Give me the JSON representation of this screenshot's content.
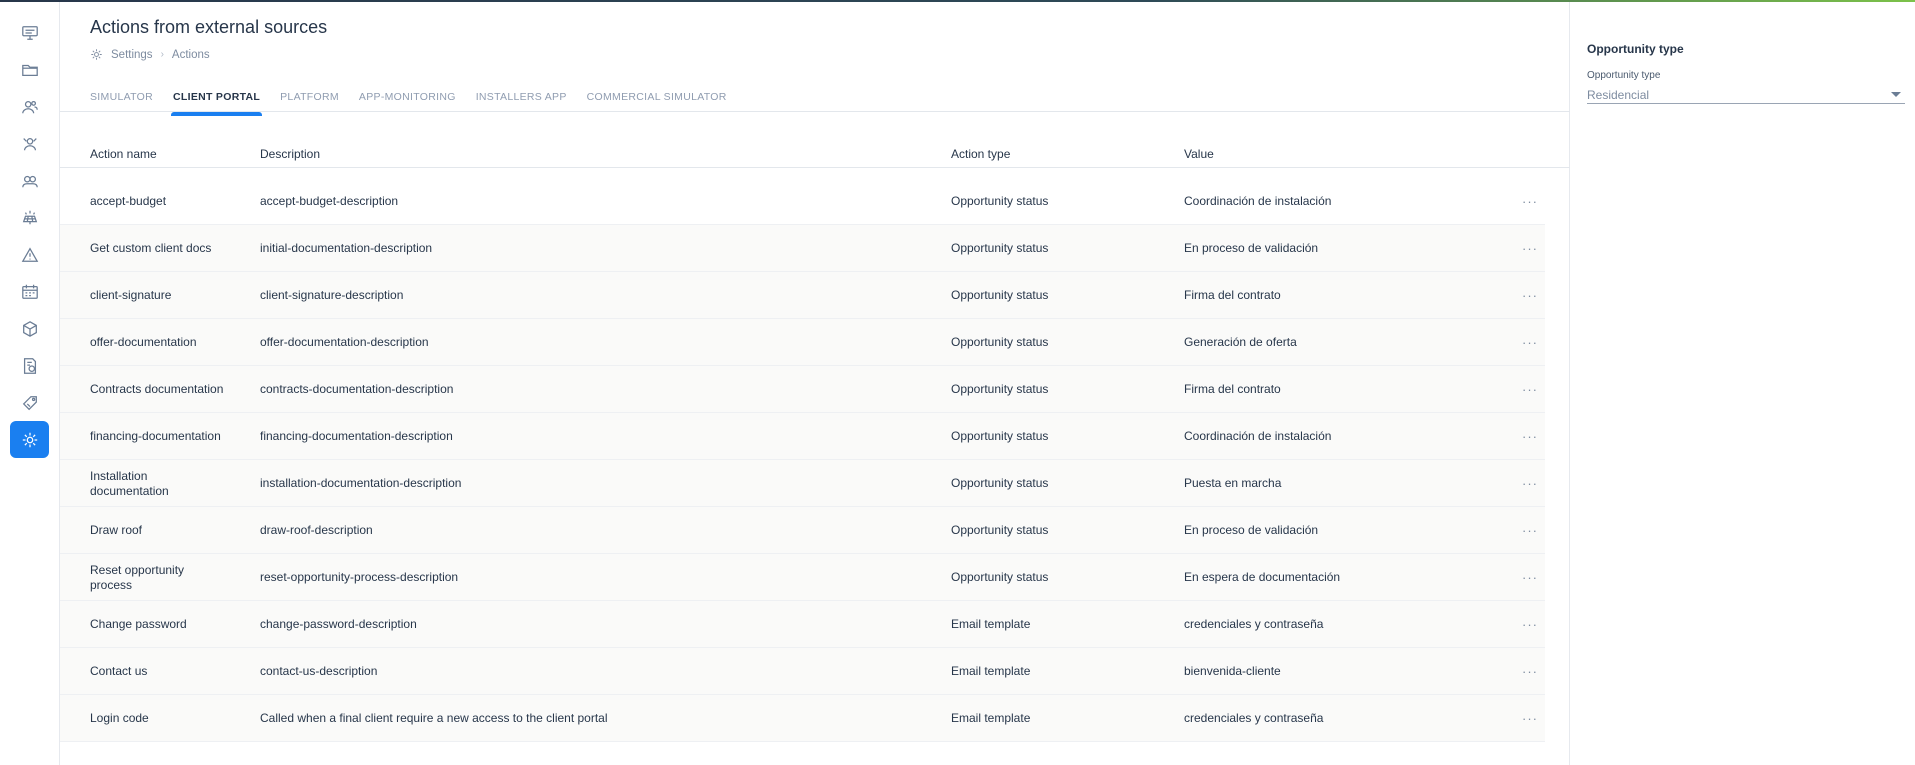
{
  "page": {
    "title": "Actions from external sources",
    "breadcrumb": [
      "Settings",
      "Actions"
    ]
  },
  "sidebar": {
    "items": [
      {
        "icon": "presentation-icon"
      },
      {
        "icon": "folder-icon"
      },
      {
        "icon": "users-icon"
      },
      {
        "icon": "team-icon"
      },
      {
        "icon": "groups-icon"
      },
      {
        "icon": "solar-panel-icon"
      },
      {
        "icon": "warning-icon"
      },
      {
        "icon": "calendar-icon"
      },
      {
        "icon": "package-icon"
      },
      {
        "icon": "billing-icon"
      },
      {
        "icon": "tag-icon"
      },
      {
        "icon": "settings-icon",
        "active": true
      }
    ]
  },
  "tabs": [
    {
      "label": "SIMULATOR"
    },
    {
      "label": "CLIENT PORTAL",
      "active": true
    },
    {
      "label": "PLATFORM"
    },
    {
      "label": "APP-MONITORING"
    },
    {
      "label": "INSTALLERS APP"
    },
    {
      "label": "COMMERCIAL SIMULATOR"
    }
  ],
  "table": {
    "columns": [
      "Action name",
      "Description",
      "Action type",
      "Value"
    ],
    "rows": [
      {
        "name": "accept-budget",
        "description": "accept-budget-description",
        "type": "Opportunity status",
        "value": "Coordinación de instalación"
      },
      {
        "name": "Get custom client docs",
        "description": "initial-documentation-description",
        "type": "Opportunity status",
        "value": "En proceso de validación"
      },
      {
        "name": "client-signature",
        "description": "client-signature-description",
        "type": "Opportunity status",
        "value": "Firma del contrato"
      },
      {
        "name": "offer-documentation",
        "description": "offer-documentation-description",
        "type": "Opportunity status",
        "value": "Generación de oferta"
      },
      {
        "name": "Contracts documentation",
        "description": "contracts-documentation-description",
        "type": "Opportunity status",
        "value": "Firma del contrato"
      },
      {
        "name": "financing-documentation",
        "description": "financing-documentation-description",
        "type": "Opportunity status",
        "value": "Coordinación de instalación"
      },
      {
        "name": "Installation documentation",
        "description": "installation-documentation-description",
        "type": "Opportunity status",
        "value": "Puesta en marcha"
      },
      {
        "name": "Draw roof",
        "description": "draw-roof-description",
        "type": "Opportunity status",
        "value": "En proceso de validación"
      },
      {
        "name": "Reset opportunity process",
        "description": "reset-opportunity-process-description",
        "type": "Opportunity status",
        "value": "En espera de documentación"
      },
      {
        "name": "Change password",
        "description": "change-password-description",
        "type": "Email template",
        "value": "credenciales y contraseña"
      },
      {
        "name": "Contact us",
        "description": "contact-us-description",
        "type": "Email template",
        "value": "bienvenida-cliente"
      },
      {
        "name": "Login code",
        "description": "Called when a final client require a new access to the client portal",
        "type": "Email template",
        "value": "credenciales y contraseña"
      }
    ],
    "more_label": "···"
  },
  "panel": {
    "title": "Opportunity type",
    "field_label": "Opportunity type",
    "field_value": "Residencial"
  },
  "colors": {
    "accent": "#1a7ff0",
    "text": "#27364a",
    "muted": "#8f9cb0"
  }
}
